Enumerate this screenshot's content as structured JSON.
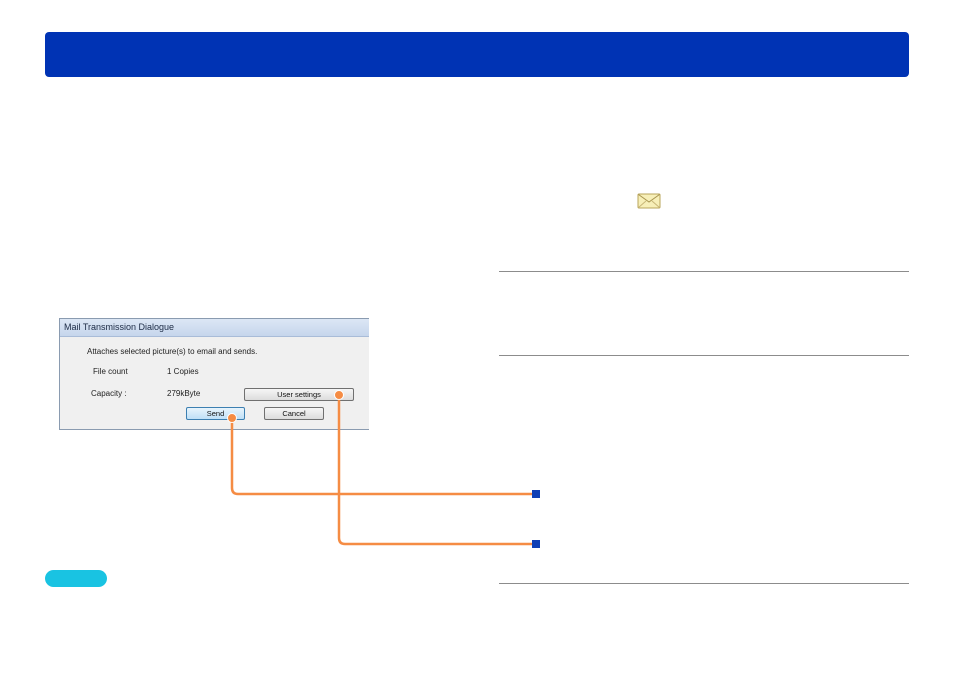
{
  "header": {
    "title": ""
  },
  "icons": {
    "mail": "mail-envelope-icon"
  },
  "dialog": {
    "title": "Mail Transmission Dialogue",
    "description": "Attaches selected picture(s) to email and sends.",
    "file_count_label": "File count",
    "file_count_value": "1 Copies",
    "capacity_label": "Capacity :",
    "capacity_value": "279kByte",
    "user_settings_label": "User settings",
    "send_label": "Send",
    "cancel_label": "Cancel"
  },
  "colors": {
    "header_bar": "#0033b4",
    "callout_line": "#f58c44",
    "marker": "#0f3fb5",
    "note_pill": "#19c3e2",
    "rule": "#8c8c8c"
  }
}
